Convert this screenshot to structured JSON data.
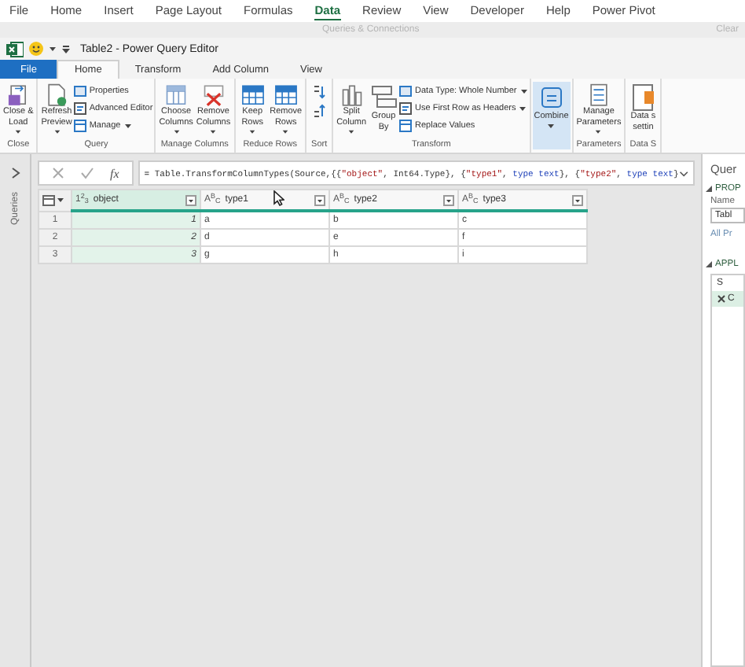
{
  "excel_menu": [
    {
      "label": "File",
      "selected": false
    },
    {
      "label": "Home",
      "selected": false
    },
    {
      "label": "Insert",
      "selected": false
    },
    {
      "label": "Page Layout",
      "selected": false
    },
    {
      "label": "Formulas",
      "selected": false
    },
    {
      "label": "Data",
      "selected": true
    },
    {
      "label": "Review",
      "selected": false
    },
    {
      "label": "View",
      "selected": false
    },
    {
      "label": "Developer",
      "selected": false
    },
    {
      "label": "Help",
      "selected": false
    },
    {
      "label": "Power Pivot",
      "selected": false
    }
  ],
  "excel_ribbon_behind": {
    "queries": "Queries & Connections",
    "clear": "Clear"
  },
  "window": {
    "title": "Table2 - Power Query Editor"
  },
  "tabs": [
    {
      "label": "File",
      "kind": "file",
      "selected": false
    },
    {
      "label": "Home",
      "kind": "tab",
      "selected": true
    },
    {
      "label": "Transform",
      "kind": "tab",
      "selected": false
    },
    {
      "label": "Add Column",
      "kind": "tab",
      "selected": false
    },
    {
      "label": "View",
      "kind": "tab",
      "selected": false
    }
  ],
  "ribbon_groups": [
    {
      "label": "Close",
      "buttons": [
        {
          "kind": "large",
          "lines": [
            "Close &",
            "Load"
          ],
          "dropdown": true,
          "highlighted": false
        }
      ]
    },
    {
      "label": "Query",
      "buttons": [
        {
          "kind": "large",
          "lines": [
            "Refresh",
            "Preview"
          ],
          "dropdown": true,
          "highlighted": false
        },
        {
          "kind": "stack",
          "items": [
            {
              "label": "Properties",
              "dropdown": false
            },
            {
              "label": "Advanced Editor",
              "dropdown": false
            },
            {
              "label": "Manage",
              "dropdown": true
            }
          ]
        }
      ]
    },
    {
      "label": "Manage Columns",
      "buttons": [
        {
          "kind": "large",
          "lines": [
            "Choose",
            "Columns"
          ],
          "dropdown": true,
          "highlighted": false
        },
        {
          "kind": "large",
          "lines": [
            "Remove",
            "Columns"
          ],
          "dropdown": true,
          "highlighted": false
        }
      ]
    },
    {
      "label": "Reduce Rows",
      "buttons": [
        {
          "kind": "large",
          "lines": [
            "Keep",
            "Rows"
          ],
          "dropdown": true,
          "highlighted": false
        },
        {
          "kind": "large",
          "lines": [
            "Remove",
            "Rows"
          ],
          "dropdown": true,
          "highlighted": false
        }
      ]
    },
    {
      "label": "Sort",
      "buttons": [
        {
          "kind": "sort"
        }
      ]
    },
    {
      "label": "Transform",
      "buttons": [
        {
          "kind": "large",
          "lines": [
            "Split",
            "Column"
          ],
          "dropdown": true,
          "highlighted": false
        },
        {
          "kind": "large",
          "lines": [
            "Group",
            "By"
          ],
          "dropdown": false,
          "highlighted": false
        },
        {
          "kind": "stack",
          "items": [
            {
              "label": "Data Type: Whole Number",
              "dropdown": true
            },
            {
              "label": "Use First Row as Headers",
              "dropdown": true
            },
            {
              "label": "Replace Values",
              "dropdown": false
            }
          ]
        }
      ]
    },
    {
      "buttons": [
        {
          "kind": "large",
          "lines": [
            "Combine"
          ],
          "dropdown": true,
          "highlighted": true
        }
      ]
    },
    {
      "label": "Parameters",
      "buttons": [
        {
          "kind": "large",
          "lines": [
            "Manage",
            "Parameters"
          ],
          "dropdown": true,
          "highlighted": false
        }
      ]
    },
    {
      "label": "Data S",
      "buttons": [
        {
          "kind": "large",
          "lines": [
            "Data s",
            "settin"
          ],
          "dropdown": false,
          "highlighted": false
        }
      ]
    }
  ],
  "queries_pane": {
    "label": "Queries"
  },
  "formula_bar": {
    "fx_label": "fx",
    "tokens": [
      {
        "text": "= Table.TransformColumnTypes(Source,{{",
        "kind": "code"
      },
      {
        "text": "\"object\"",
        "kind": "string"
      },
      {
        "text": ", Int64.Type}, {",
        "kind": "code"
      },
      {
        "text": "\"type1\"",
        "kind": "string"
      },
      {
        "text": ", ",
        "kind": "code"
      },
      {
        "text": "type text",
        "kind": "keyword"
      },
      {
        "text": "}, {",
        "kind": "code"
      },
      {
        "text": "\"type2\"",
        "kind": "string"
      },
      {
        "text": ", ",
        "kind": "code"
      },
      {
        "text": "type text",
        "kind": "keyword"
      },
      {
        "text": "}",
        "kind": "code"
      }
    ]
  },
  "table": {
    "columns": [
      {
        "type_icon": "1$^{2}$$_{3}$",
        "name": "object",
        "kind": "number",
        "selected": true
      },
      {
        "type_icon": "A$^{B}$$_{C}$",
        "name": "type1",
        "kind": "text",
        "selected": false
      },
      {
        "type_icon": "A$^{B}$$_{C}$",
        "name": "type2",
        "kind": "text",
        "selected": false
      },
      {
        "type_icon": "A$^{B}$$_{C}$",
        "name": "type3",
        "kind": "text",
        "selected": false
      }
    ],
    "rows": [
      {
        "number": "1",
        "cells": [
          "1",
          "a",
          "b",
          "c"
        ]
      },
      {
        "number": "2",
        "cells": [
          "2",
          "d",
          "e",
          "f"
        ]
      },
      {
        "number": "3",
        "cells": [
          "3",
          "g",
          "h",
          "i"
        ]
      }
    ]
  },
  "query_settings": {
    "title": "Quer",
    "properties_heading": "PROP",
    "name_label": "Name",
    "name_value": "Tabl",
    "all_properties_link": "All Pr",
    "applied_steps_heading": "APPL",
    "steps": [
      {
        "label": "S",
        "kind": "plain",
        "selected": false
      },
      {
        "label": "C",
        "kind": "removable",
        "selected": true
      }
    ]
  }
}
